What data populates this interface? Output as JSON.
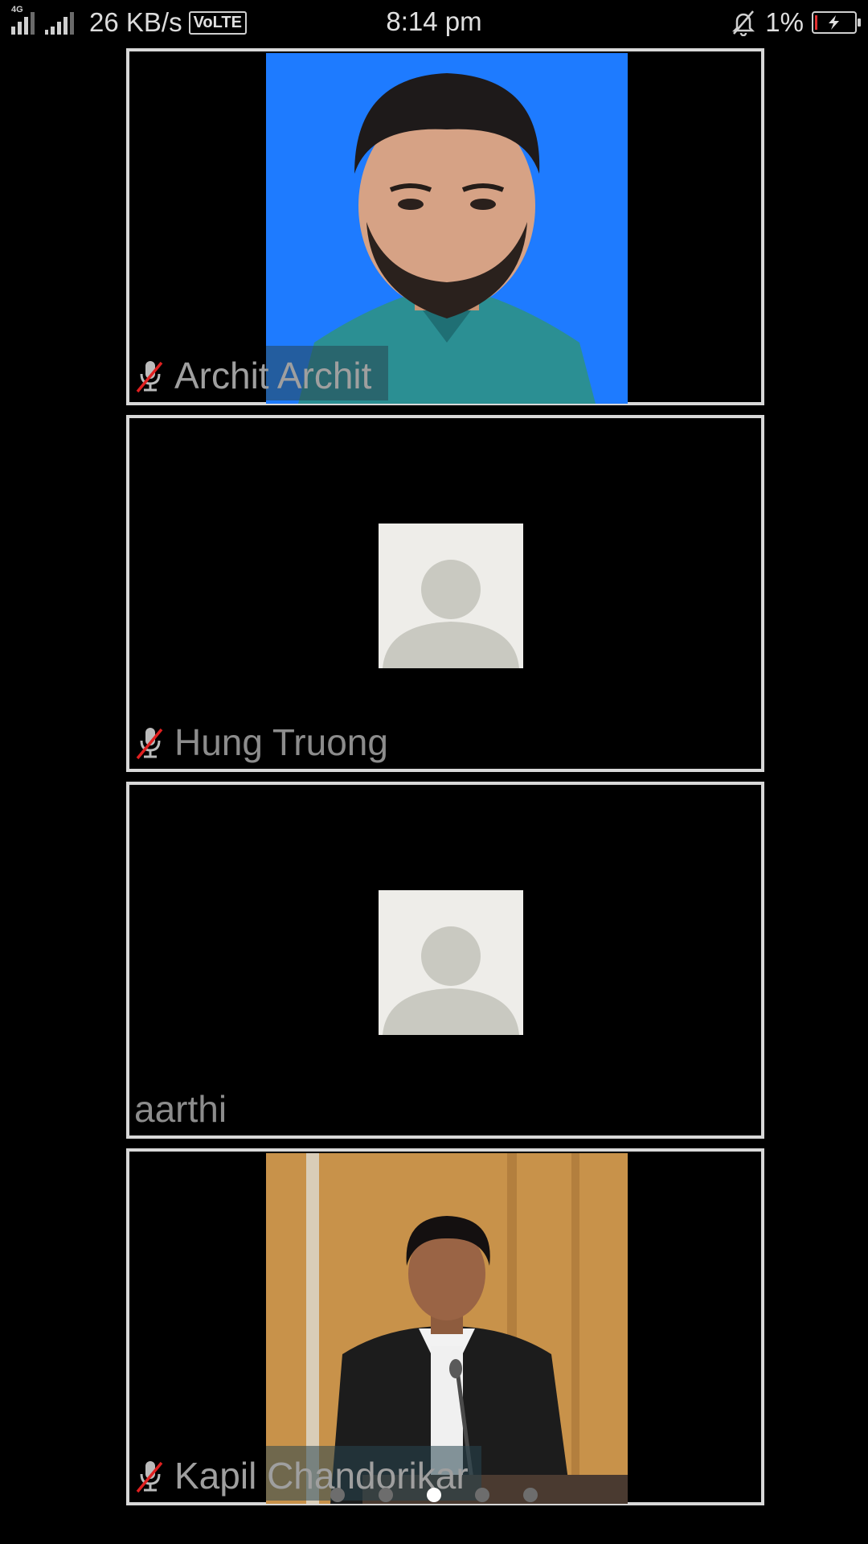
{
  "status_bar": {
    "network1": "4G",
    "speed": "26 KB/s",
    "volte": "VoLTE",
    "time": "8:14 pm",
    "battery_percent": "1%"
  },
  "participants": [
    {
      "name": "Archit Archit",
      "muted": true,
      "has_video": true
    },
    {
      "name": "Hung Truong",
      "muted": true,
      "has_video": false
    },
    {
      "name": "aarthi",
      "muted": false,
      "has_video": false
    },
    {
      "name": "Kapil Chandorikar",
      "muted": true,
      "has_video": true
    }
  ],
  "pager": {
    "pages": 5,
    "active_index": 2
  },
  "colors": {
    "tile_border": "#d8d8d8",
    "photo1_bg": "#1e7bff",
    "photo2_bg": "#c8924a",
    "mute_slash": "#e02020"
  }
}
